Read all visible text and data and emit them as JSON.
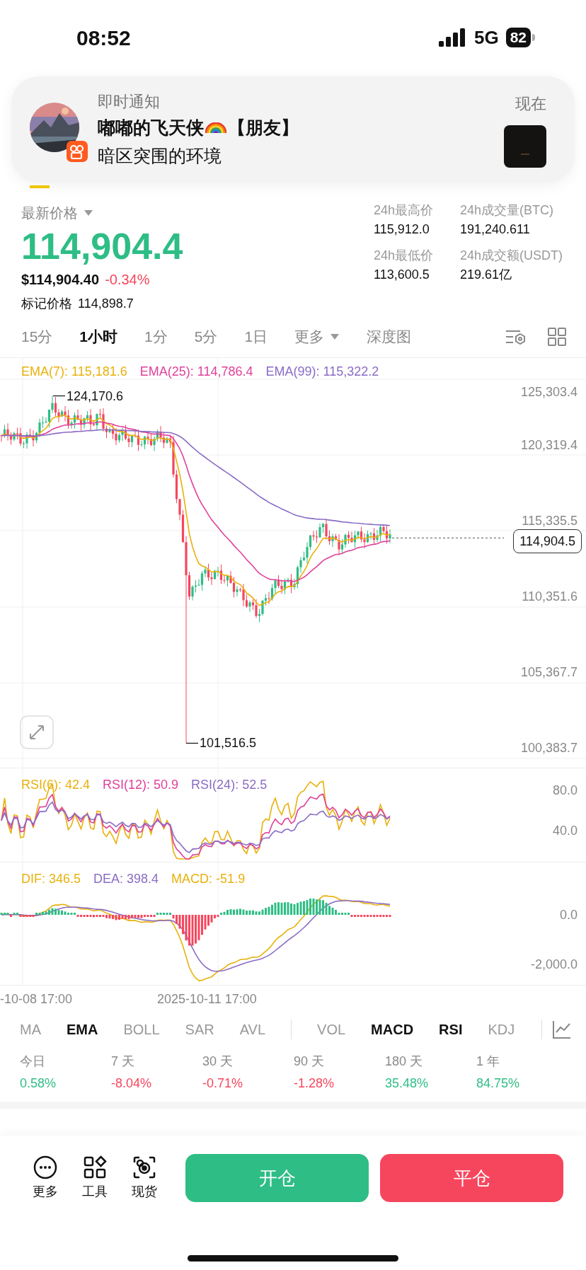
{
  "status_bar": {
    "time": "08:52",
    "network": "5G",
    "battery": "82"
  },
  "notification": {
    "app_label": "即时通知",
    "time": "现在",
    "sender": "嘟嘟的飞天侠",
    "tag": "【朋友】",
    "body": "暗区突围的环境"
  },
  "ticker": {
    "price_label": "最新价格",
    "last_price": "114,904.4",
    "usd_price": "$114,904.40",
    "change": "-0.34%",
    "mark_label": "标记价格",
    "mark_price": "114,898.7",
    "stats": [
      {
        "label": "24h最高价",
        "value": "115,912.0"
      },
      {
        "label": "24h成交量(BTC)",
        "value": "191,240.611"
      },
      {
        "label": "24h最低价",
        "value": "113,600.5"
      },
      {
        "label": "24h成交额(USDT)",
        "value": "219.61亿"
      }
    ]
  },
  "intervals": [
    {
      "label": "15分",
      "selected": false,
      "kind": "tab"
    },
    {
      "label": "1小时",
      "selected": true,
      "kind": "tab"
    },
    {
      "label": "1分",
      "selected": false,
      "kind": "tab"
    },
    {
      "label": "5分",
      "selected": false,
      "kind": "tab"
    },
    {
      "label": "1日",
      "selected": false,
      "kind": "tab"
    },
    {
      "label": "更多",
      "selected": false,
      "kind": "dropdown"
    },
    {
      "label": "深度图",
      "selected": false,
      "kind": "tab"
    }
  ],
  "chart": {
    "legend": [
      {
        "label": "EMA(7): 115,181.6",
        "color": "#e8b10b"
      },
      {
        "label": "EMA(25): 114,786.4",
        "color": "#e0409a"
      },
      {
        "label": "EMA(99): 115,322.2",
        "color": "#8a6cc4"
      }
    ],
    "price_axis": [
      "125,303.4",
      "120,319.4",
      "115,335.5",
      "110,351.6",
      "105,367.7",
      "100,383.7"
    ],
    "high_label": "124,170.6",
    "low_label": "101,516.5",
    "current_price": "114,904.5"
  },
  "rsi": {
    "legend": [
      {
        "label": "RSI(6): 42.4",
        "color": "#e8b10b"
      },
      {
        "label": "RSI(12): 50.9",
        "color": "#e0409a"
      },
      {
        "label": "RSI(24): 52.5",
        "color": "#8a6cc4"
      }
    ],
    "axis": [
      "80.0",
      "40.0"
    ]
  },
  "macd": {
    "legend": [
      {
        "label": "DIF: 346.5",
        "color": "#e8b10b"
      },
      {
        "label": "DEA: 398.4",
        "color": "#8a6cc4"
      },
      {
        "label": "MACD: -51.9",
        "color": "#e8b10b"
      }
    ],
    "axis": [
      "0.0",
      "-2,000.0"
    ]
  },
  "time_axis": [
    "-10-08 17:00",
    "2025-10-11 17:00"
  ],
  "main_indicators": [
    {
      "label": "MA",
      "selected": false
    },
    {
      "label": "EMA",
      "selected": true
    },
    {
      "label": "BOLL",
      "selected": false
    },
    {
      "label": "SAR",
      "selected": false
    },
    {
      "label": "AVL",
      "selected": false
    }
  ],
  "sub_indicators": [
    {
      "label": "VOL",
      "selected": false
    },
    {
      "label": "MACD",
      "selected": true
    },
    {
      "label": "RSI",
      "selected": true
    },
    {
      "label": "KDJ",
      "selected": false
    }
  ],
  "performance": [
    {
      "label": "今日",
      "value": "0.58%",
      "color": "#2ebd85"
    },
    {
      "label": "7 天",
      "value": "-8.04%",
      "color": "#f6465d"
    },
    {
      "label": "30 天",
      "value": "-0.71%",
      "color": "#f6465d"
    },
    {
      "label": "90 天",
      "value": "-1.28%",
      "color": "#f6465d"
    },
    {
      "label": "180 天",
      "value": "35.48%",
      "color": "#2ebd85"
    },
    {
      "label": "1 年",
      "value": "84.75%",
      "color": "#2ebd85"
    }
  ],
  "bottom_bar": {
    "tools": [
      {
        "label": "更多",
        "kind": "more"
      },
      {
        "label": "工具",
        "kind": "tools"
      },
      {
        "label": "现货",
        "kind": "spot"
      }
    ],
    "buttons": [
      {
        "label": "开仓",
        "kind": "open"
      },
      {
        "label": "平仓",
        "kind": "close"
      }
    ]
  }
}
